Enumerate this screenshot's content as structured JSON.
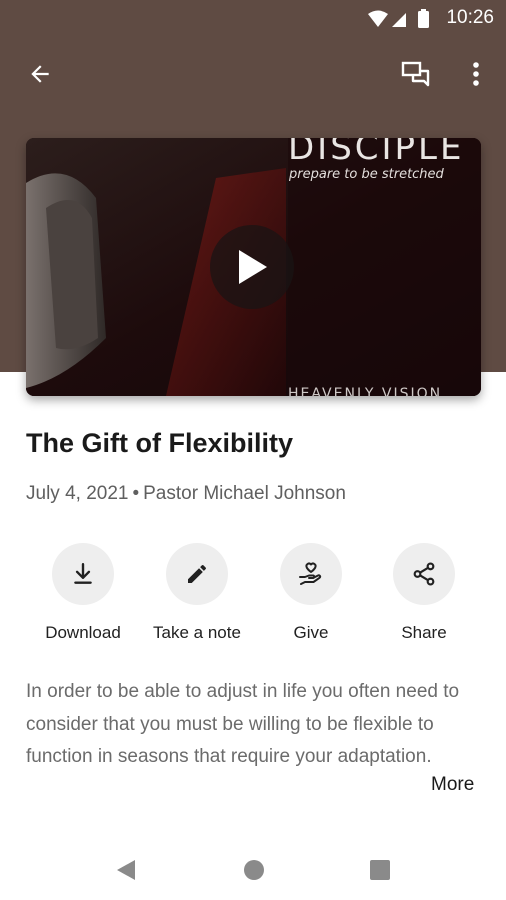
{
  "status_bar": {
    "time": "10:26"
  },
  "video": {
    "title": "DISCIPLE",
    "subtitle": "prepare to be stretched",
    "footer": "HEAVENLY VISION"
  },
  "sermon": {
    "title": "The Gift of Flexibility",
    "date": "July 4, 2021",
    "separator": "•",
    "speaker": "Pastor Michael Johnson",
    "description": "In order to be able to adjust in life you often need to consider that you must be willing to be flexible to function in seasons that require your adaptation.",
    "more_label": "More"
  },
  "actions": {
    "download": "Download",
    "note": "Take a note",
    "give": "Give",
    "share": "Share"
  },
  "icons": {
    "back": "arrow-back-icon",
    "chat": "chat-icon",
    "more": "more-vert-icon",
    "play": "play-icon",
    "download": "download-icon",
    "note": "pencil-icon",
    "give": "heart-hand-icon",
    "share": "share-icon"
  },
  "colors": {
    "header": "#5f4b43",
    "action_circle": "#eeeeee",
    "nav_icon": "#8a8a8a"
  }
}
